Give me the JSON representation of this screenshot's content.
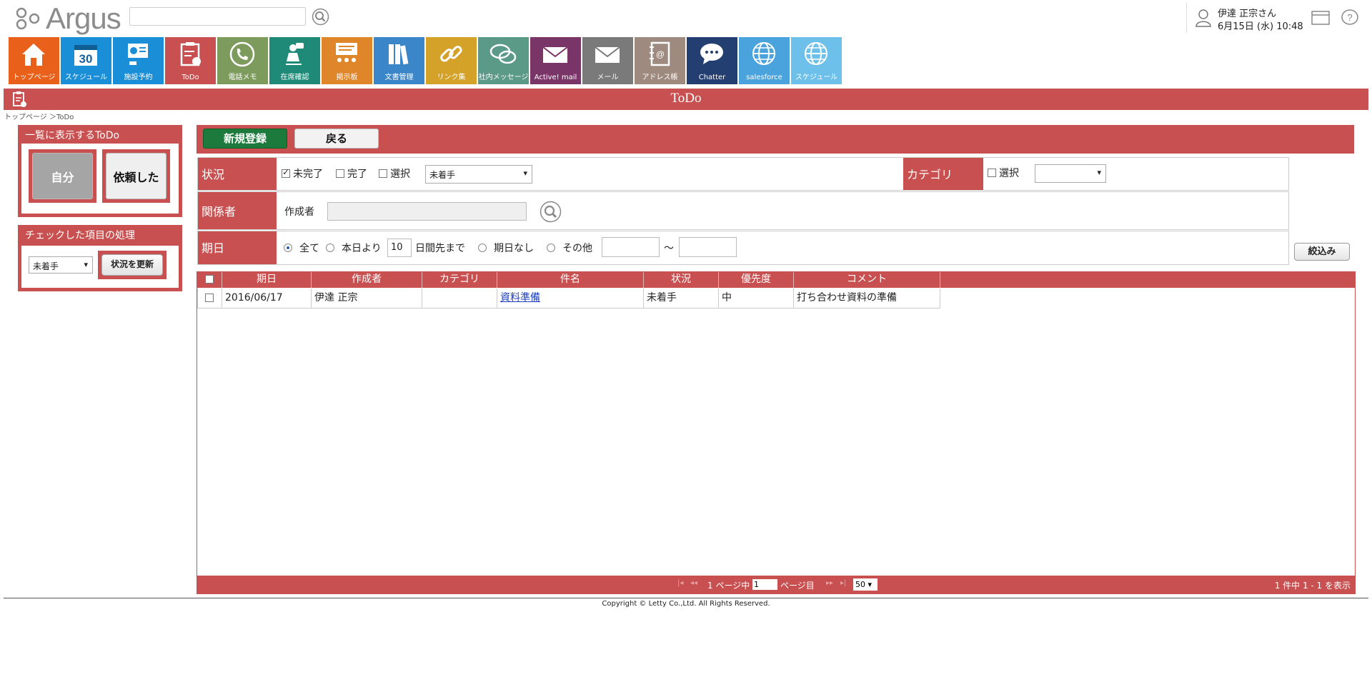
{
  "app": {
    "logo_text": "Argus"
  },
  "search": {
    "value": ""
  },
  "user": {
    "name": "伊達 正宗さん",
    "datetime": "6月15日 (水) 10:48"
  },
  "tiles": [
    {
      "label": "トップページ",
      "color": "#e8601a",
      "icon": "home-icon"
    },
    {
      "label": "スケジュール",
      "color": "#1a8ed6",
      "icon": "calendar-icon"
    },
    {
      "label": "施設予約",
      "color": "#1a8ed6",
      "icon": "facility-icon"
    },
    {
      "label": "ToDo",
      "color": "#c85050",
      "icon": "todo-icon"
    },
    {
      "label": "電話メモ",
      "color": "#7d9b5c",
      "icon": "phone-icon"
    },
    {
      "label": "在席確認",
      "color": "#1f8a78",
      "icon": "presence-icon"
    },
    {
      "label": "掲示板",
      "color": "#e0862a",
      "icon": "board-icon"
    },
    {
      "label": "文書管理",
      "color": "#3a86c8",
      "icon": "document-icon"
    },
    {
      "label": "リンク集",
      "color": "#d4a129",
      "icon": "link-icon"
    },
    {
      "label": "社内メッセージ",
      "color": "#5b9a87",
      "icon": "message-icon"
    },
    {
      "label": "Active! mail",
      "color": "#7a3568",
      "icon": "mail-icon"
    },
    {
      "label": "メール",
      "color": "#7a7a7a",
      "icon": "mail-icon"
    },
    {
      "label": "アドレス帳",
      "color": "#9e8a7e",
      "icon": "address-book-icon"
    },
    {
      "label": "Chatter",
      "color": "#233e70",
      "icon": "chat-icon"
    },
    {
      "label": "salesforce",
      "color": "#4aa3dd",
      "icon": "globe-icon"
    },
    {
      "label": "スケジュール",
      "color": "#6cc0ea",
      "icon": "globe-icon"
    }
  ],
  "page": {
    "title": "ToDo",
    "breadcrumb": "トップページ ＞ToDo"
  },
  "left_panel": {
    "display_title": "一覧に表示するToDo",
    "self_label": "自分",
    "requested_label": "依頼した",
    "process_title": "チェックした項目の処理",
    "status_select": "未着手",
    "update_label": "状況を更新"
  },
  "toolbar": {
    "new_label": "新規登録",
    "back_label": "戻る"
  },
  "filters": {
    "status_label": "状況",
    "incomplete_label": "未完了",
    "complete_label": "完了",
    "select_label": "選択",
    "status_select": "未着手",
    "category_label": "カテゴリ",
    "category_select_label": "選択",
    "category_select": "",
    "person_label": "関係者",
    "creator_label": "作成者",
    "creator_value": "",
    "date_label": "期日",
    "all_label": "全て",
    "from_today_label": "本日より",
    "days_value": "10",
    "days_ahead_label": "日間先まで",
    "no_date_label": "期日なし",
    "other_label": "その他",
    "date_from": "",
    "date_sep": "～",
    "date_to": "",
    "filter_button": "絞込み"
  },
  "table": {
    "headers": [
      "期日",
      "作成者",
      "カテゴリ",
      "件名",
      "状況",
      "優先度",
      "コメント"
    ],
    "rows": [
      {
        "date": "2016/06/17",
        "creator": "伊達 正宗",
        "category": "",
        "subject": "資料準備",
        "status": "未着手",
        "priority": "中",
        "comment": "打ち合わせ資料の準備"
      }
    ]
  },
  "pager": {
    "page_prefix": "1 ページ中",
    "page_value": "1",
    "page_suffix": "ページ目",
    "per_page": "50",
    "summary": "1 件中 1 - 1 を表示"
  },
  "footer": {
    "copyright": "Copyright © Letty Co.,Ltd. All Rights Reserved."
  }
}
